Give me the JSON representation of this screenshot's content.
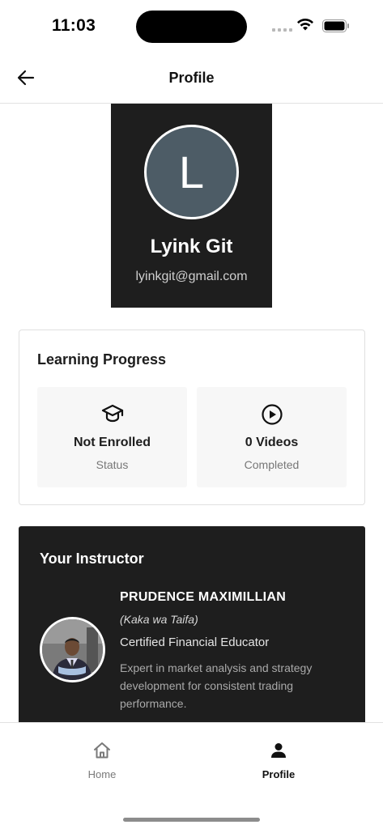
{
  "status_bar": {
    "time": "11:03"
  },
  "header": {
    "title": "Profile"
  },
  "profile": {
    "avatar_initial": "L",
    "name": "Lyink Git",
    "email": "lyinkgit@gmail.com"
  },
  "learning_progress": {
    "title": "Learning Progress",
    "stats": [
      {
        "value": "Not Enrolled",
        "label": "Status",
        "icon": "graduation-cap-icon"
      },
      {
        "value": "0 Videos",
        "label": "Completed",
        "icon": "play-circle-icon"
      }
    ]
  },
  "instructor": {
    "section_title": "Your Instructor",
    "name": "PRUDENCE MAXIMILLIAN",
    "nickname": "(Kaka wa Taifa)",
    "role": "Certified Financial Educator",
    "bio": "Expert in market analysis and strategy development for consistent trading performance."
  },
  "bottom_nav": {
    "items": [
      {
        "label": "Home",
        "icon": "home-icon",
        "active": false
      },
      {
        "label": "Profile",
        "icon": "person-icon",
        "active": true
      }
    ]
  },
  "colors": {
    "dark_card": "#1e1e1e",
    "avatar_bg": "#4d5c66",
    "stat_box_bg": "#f7f7f7"
  }
}
